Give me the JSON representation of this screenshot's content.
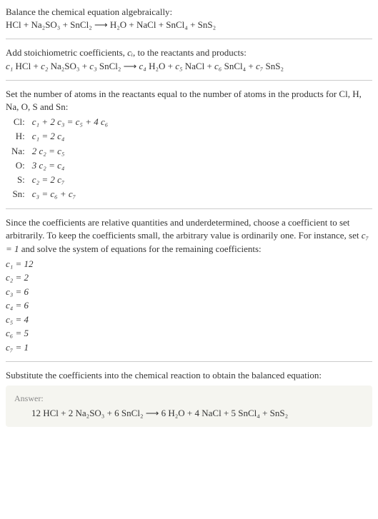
{
  "section1": {
    "line1": "Balance the chemical equation algebraically:",
    "line2": "HCl + Na₂SO₃ + SnCl₂ ⟶ H₂O + NaCl + SnCl₄ + SnS₂"
  },
  "section2": {
    "line1_part1": "Add stoichiometric coefficients, ",
    "line1_ci": "cᵢ",
    "line1_part2": ", to the reactants and products:",
    "line2_c1": "c₁",
    "line2_r1": " HCl + ",
    "line2_c2": "c₂",
    "line2_r2": " Na₂SO₃ + ",
    "line2_c3": "c₃",
    "line2_r3": " SnCl₂ ⟶ ",
    "line2_c4": "c₄",
    "line2_r4": " H₂O + ",
    "line2_c5": "c₅",
    "line2_r5": " NaCl + ",
    "line2_c6": "c₆",
    "line2_r6": " SnCl₄ + ",
    "line2_c7": "c₇",
    "line2_r7": " SnS₂"
  },
  "section3": {
    "intro": "Set the number of atoms in the reactants equal to the number of atoms in the products for Cl, H, Na, O, S and Sn:",
    "rows": [
      {
        "label": "Cl:",
        "eq": "c₁ + 2 c₃ = c₅ + 4 c₆"
      },
      {
        "label": "H:",
        "eq": "c₁ = 2 c₄"
      },
      {
        "label": "Na:",
        "eq": "2 c₂ = c₅"
      },
      {
        "label": "O:",
        "eq": "3 c₂ = c₄"
      },
      {
        "label": "S:",
        "eq": "c₂ = 2 c₇"
      },
      {
        "label": "Sn:",
        "eq": "c₃ = c₆ + c₇"
      }
    ]
  },
  "section4": {
    "intro_part1": "Since the coefficients are relative quantities and underdetermined, choose a coefficient to set arbitrarily. To keep the coefficients small, the arbitrary value is ordinarily one. For instance, set ",
    "intro_c7": "c₇ = 1",
    "intro_part2": " and solve the system of equations for the remaining coefficients:",
    "coefs": [
      "c₁ = 12",
      "c₂ = 2",
      "c₃ = 6",
      "c₄ = 6",
      "c₅ = 4",
      "c₆ = 5",
      "c₇ = 1"
    ]
  },
  "section5": {
    "intro": "Substitute the coefficients into the chemical reaction to obtain the balanced equation:",
    "answer_label": "Answer:",
    "answer": "12 HCl + 2 Na₂SO₃ + 6 SnCl₂ ⟶ 6 H₂O + 4 NaCl + 5 SnCl₄ + SnS₂"
  },
  "chart_data": {
    "type": "table",
    "title": "Chemical equation balancing",
    "unbalanced_equation": "HCl + Na2SO3 + SnCl2 -> H2O + NaCl + SnCl4 + SnS2",
    "elements": [
      "Cl",
      "H",
      "Na",
      "O",
      "S",
      "Sn"
    ],
    "atom_balance_equations": {
      "Cl": "c1 + 2 c3 = c5 + 4 c6",
      "H": "c1 = 2 c4",
      "Na": "2 c2 = c5",
      "O": "3 c2 = c4",
      "S": "c2 = 2 c7",
      "Sn": "c3 = c6 + c7"
    },
    "arbitrary_set": {
      "c7": 1
    },
    "solved_coefficients": {
      "c1": 12,
      "c2": 2,
      "c3": 6,
      "c4": 6,
      "c5": 4,
      "c6": 5,
      "c7": 1
    },
    "balanced_equation": "12 HCl + 2 Na2SO3 + 6 SnCl2 -> 6 H2O + 4 NaCl + 5 SnCl4 + SnS2"
  }
}
